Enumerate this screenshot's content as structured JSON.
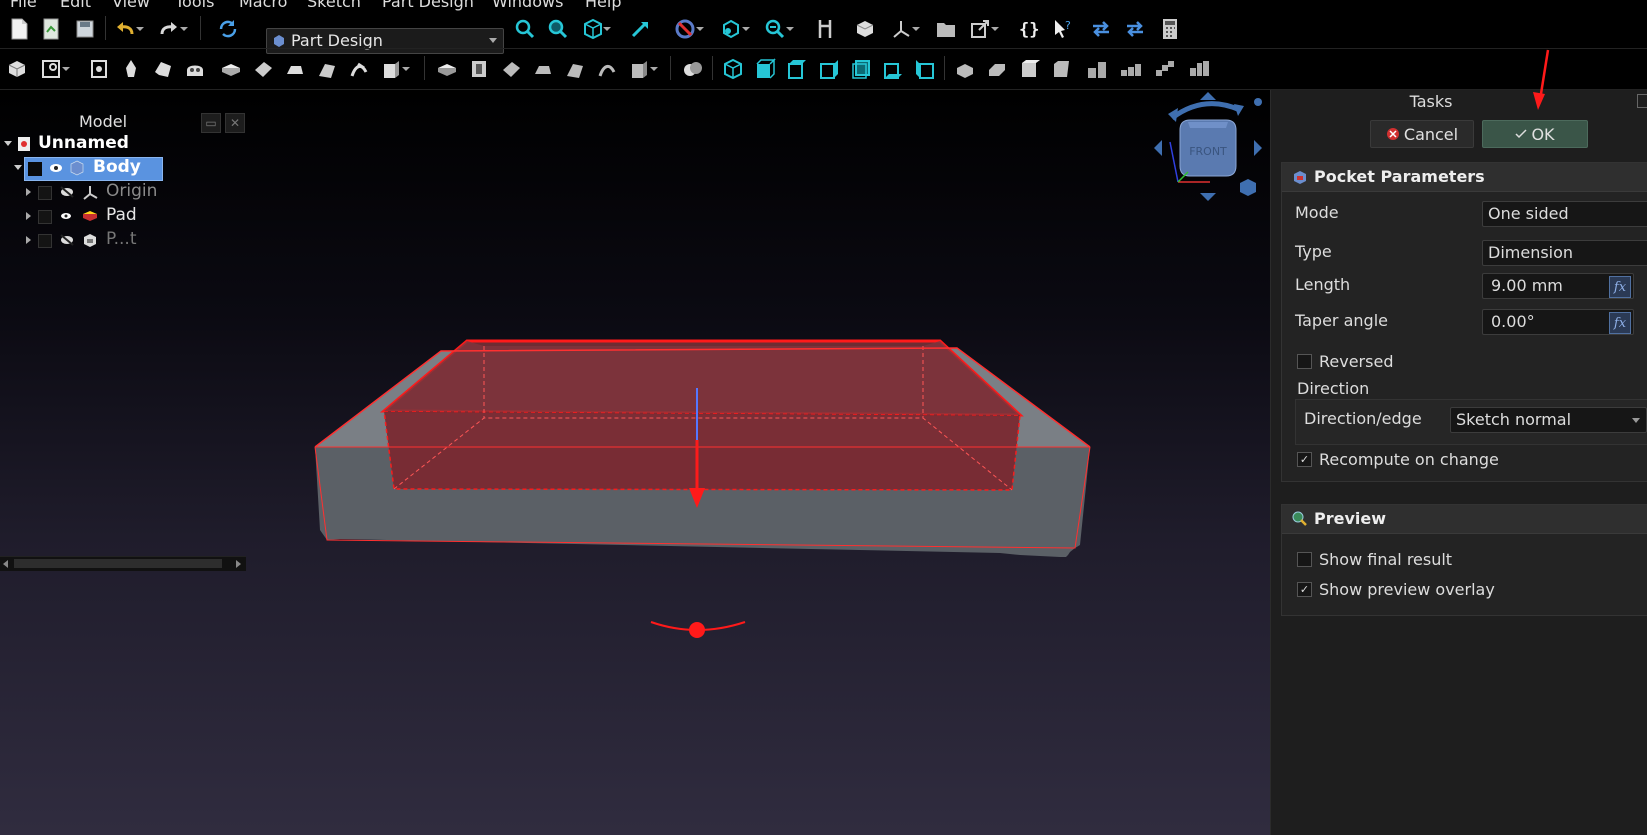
{
  "menu": {
    "items": [
      "File",
      "Edit",
      "View",
      "Tools",
      "Macro",
      "Sketch",
      "Part Design",
      "Windows",
      "Help"
    ]
  },
  "toolbar": {
    "workbench": "Part Design"
  },
  "tree": {
    "header": "Model",
    "root": "Unnamed",
    "items": [
      {
        "label": "Body"
      },
      {
        "label": "Origin"
      },
      {
        "label": "Pad"
      },
      {
        "label": "P...t"
      }
    ]
  },
  "navcube": {
    "face": "FRONT"
  },
  "tasks": {
    "title": "Tasks",
    "cancel": "Cancel",
    "ok": "OK",
    "pocket": {
      "header": "Pocket Parameters",
      "mode_label": "Mode",
      "mode_value": "One sided",
      "type_label": "Type",
      "type_value": "Dimension",
      "length_label": "Length",
      "length_value": "9.00 mm",
      "taper_label": "Taper angle",
      "taper_value": "0.00°",
      "reversed_label": "Reversed",
      "reversed_checked": false,
      "direction_label": "Direction",
      "direction_edge_label": "Direction/edge",
      "direction_edge_value": "Sketch normal",
      "recompute_label": "Recompute on change",
      "recompute_checked": true,
      "fx": "fx"
    },
    "preview": {
      "header": "Preview",
      "final_label": "Show final result",
      "final_checked": false,
      "overlay_label": "Show preview overlay",
      "overlay_checked": true
    }
  },
  "colors": {
    "accent_selection": "#5a93e0",
    "pocket_red": "#ff1a1a",
    "ok_button": "#3a5548"
  }
}
